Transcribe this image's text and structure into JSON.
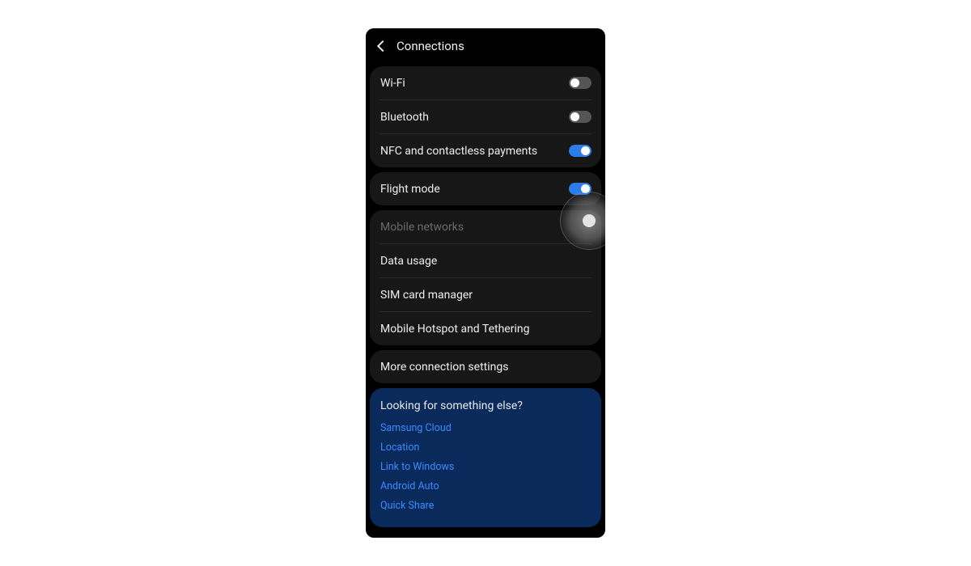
{
  "header": {
    "title": "Connections"
  },
  "groups": [
    {
      "rows": [
        {
          "label": "Wi-Fi",
          "toggle": "off"
        },
        {
          "label": "Bluetooth",
          "toggle": "off"
        },
        {
          "label": "NFC and contactless payments",
          "toggle": "on"
        }
      ]
    },
    {
      "rows": [
        {
          "label": "Flight mode",
          "toggle": "on"
        }
      ]
    },
    {
      "rows": [
        {
          "label": "Mobile networks",
          "disabled": true
        },
        {
          "label": "Data usage"
        },
        {
          "label": "SIM card manager"
        },
        {
          "label": "Mobile Hotspot and Tethering"
        }
      ]
    },
    {
      "rows": [
        {
          "label": "More connection settings"
        }
      ]
    }
  ],
  "help": {
    "title": "Looking for something else?",
    "links": [
      "Samsung Cloud",
      "Location",
      "Link to Windows",
      "Android Auto",
      "Quick Share"
    ]
  }
}
